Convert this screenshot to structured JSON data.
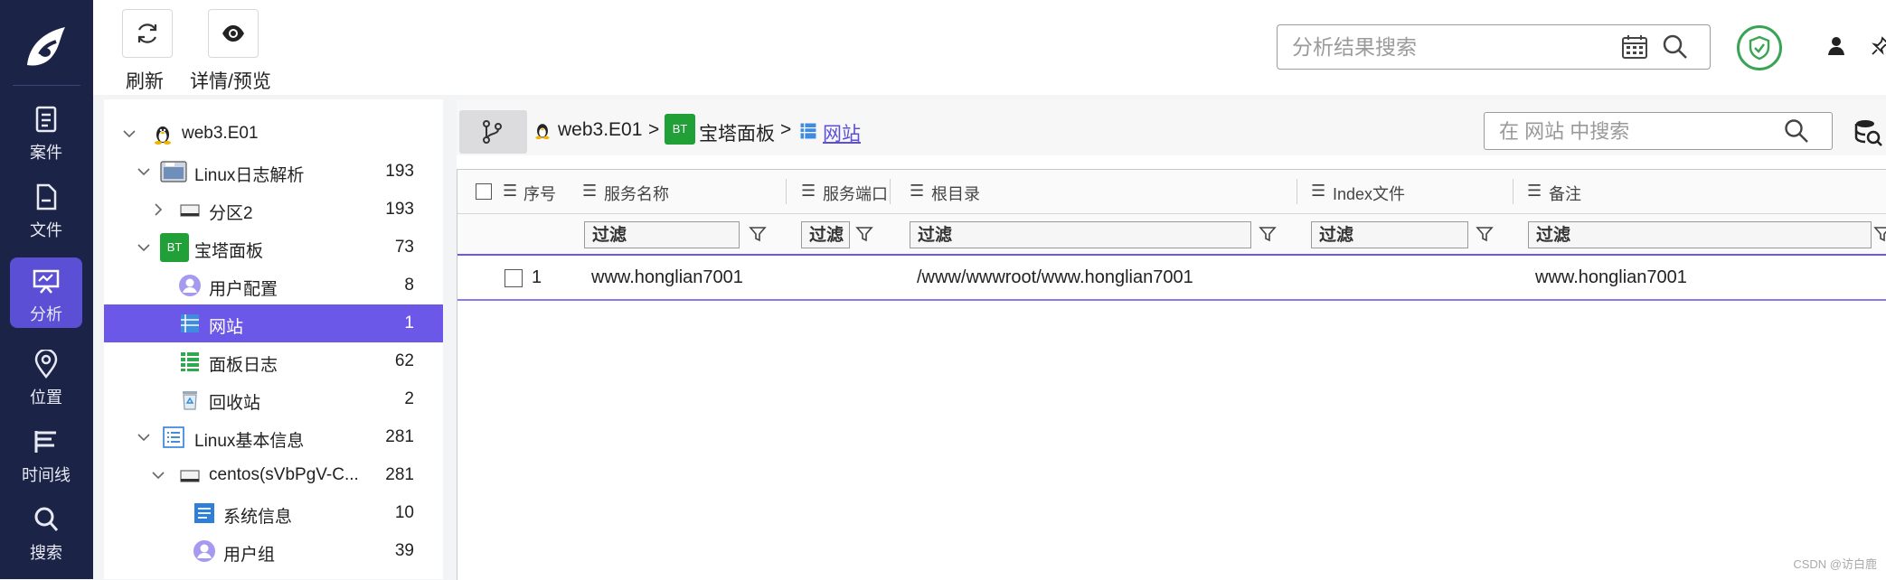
{
  "nav": {
    "items": [
      {
        "label": "案件",
        "icon": "case-icon"
      },
      {
        "label": "文件",
        "icon": "file-icon"
      },
      {
        "label": "分析",
        "icon": "analysis-icon",
        "active": true
      },
      {
        "label": "位置",
        "icon": "location-icon"
      },
      {
        "label": "时间线",
        "icon": "timeline-icon"
      },
      {
        "label": "搜索",
        "icon": "search-icon"
      }
    ]
  },
  "toolbar": {
    "refresh_label": "刷新",
    "preview_label": "详情/预览",
    "search_placeholder": "分析结果搜索"
  },
  "tree": {
    "root": {
      "label": "web3.E01"
    },
    "items": [
      {
        "label": "Linux日志解析",
        "count": "193"
      },
      {
        "label": "分区2",
        "count": "193"
      },
      {
        "label": "宝塔面板",
        "count": "73",
        "badge": "BT"
      },
      {
        "label": "用户配置",
        "count": "8"
      },
      {
        "label": "网站",
        "count": "1",
        "selected": true
      },
      {
        "label": "面板日志",
        "count": "62"
      },
      {
        "label": "回收站",
        "count": "2"
      },
      {
        "label": "Linux基本信息",
        "count": "281"
      },
      {
        "label": "centos(sVbPgV-C...",
        "count": "281"
      },
      {
        "label": "系统信息",
        "count": "10"
      },
      {
        "label": "用户组",
        "count": "39"
      }
    ]
  },
  "breadcrumb": {
    "items": [
      "web3.E01",
      "宝塔面板",
      "网站"
    ],
    "separator": ">",
    "bt_badge": "BT"
  },
  "inner_search": {
    "placeholder": "在 网站 中搜索"
  },
  "table": {
    "columns": [
      "序号",
      "服务名称",
      "服务端口",
      "根目录",
      "Index文件",
      "备注"
    ],
    "filter_placeholder": "过滤",
    "rows": [
      {
        "index": "1",
        "name": "www.honglian7001",
        "port": "",
        "root": "/www/wwwroot/www.honglian7001",
        "index_file": "",
        "note": "www.honglian7001"
      }
    ]
  },
  "watermark": "CSDN @访白鹿",
  "colors": {
    "nav_bg": "#1b2346",
    "accent": "#6b58e8",
    "shield_green": "#3aa455",
    "bt_green": "#21a038"
  }
}
